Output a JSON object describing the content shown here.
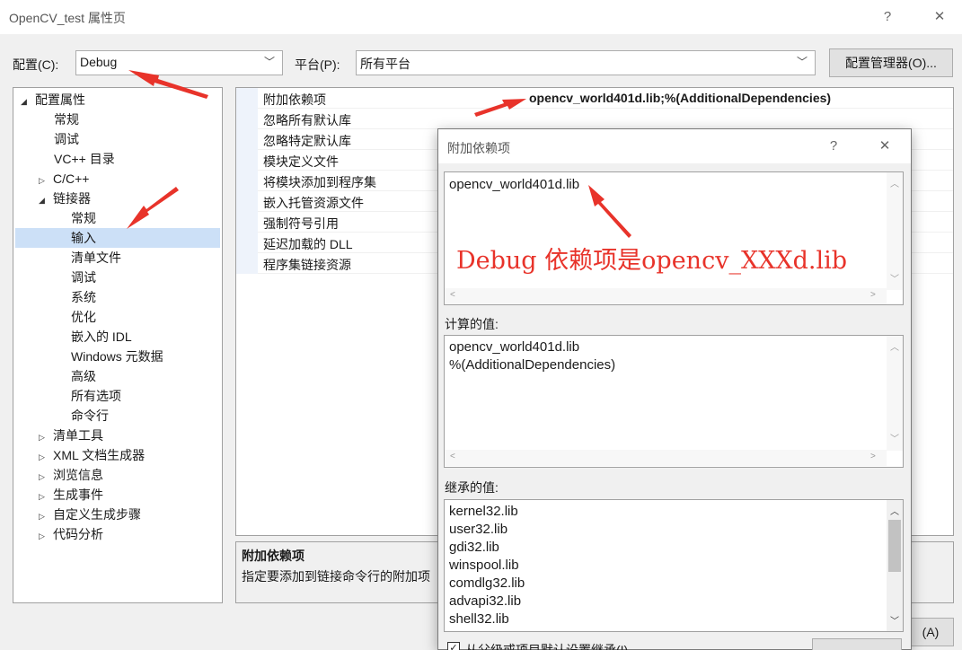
{
  "window": {
    "title": "OpenCV_test 属性页",
    "help_glyph": "?",
    "close_glyph": "✕"
  },
  "config_bar": {
    "config_label": "配置(C):",
    "config_value": "Debug",
    "platform_label": "平台(P):",
    "platform_value": "所有平台",
    "manager_button": "配置管理器(O)..."
  },
  "tree": {
    "root": "配置属性",
    "items": [
      "常规",
      "调试",
      "VC++ 目录",
      "C/C++",
      "链接器",
      "常规",
      "输入",
      "清单文件",
      "调试",
      "系统",
      "优化",
      "嵌入的 IDL",
      "Windows 元数据",
      "高级",
      "所有选项",
      "命令行",
      "清单工具",
      "XML 文档生成器",
      "浏览信息",
      "生成事件",
      "自定义生成步骤",
      "代码分析"
    ],
    "selected": "输入"
  },
  "grid": {
    "rows": [
      "附加依赖项",
      "忽略所有默认库",
      "忽略特定默认库",
      "模块定义文件",
      "将模块添加到程序集",
      "嵌入托管资源文件",
      "强制符号引用",
      "延迟加载的 DLL",
      "程序集链接资源"
    ],
    "first_value": "opencv_world401d.lib;%(AdditionalDependencies)"
  },
  "description": {
    "title": "附加依赖项",
    "text": "指定要添加到链接命令行的附加项"
  },
  "dialog": {
    "title": "附加依赖项",
    "help_glyph": "?",
    "close_glyph": "✕",
    "edit_value": "opencv_world401d.lib",
    "computed_label": "计算的值:",
    "computed_lines": [
      "opencv_world401d.lib",
      "%(AdditionalDependencies)"
    ],
    "inherited_label": "继承的值:",
    "inherited_lines": [
      "kernel32.lib",
      "user32.lib",
      "gdi32.lib",
      "winspool.lib",
      "comdlg32.lib",
      "advapi32.lib",
      "shell32.lib"
    ],
    "inherit_checkbox": "从父级或项目默认设置继承(I)",
    "apply_button": "(A)"
  },
  "annotation": {
    "text": "Debug 依赖项是opencv_XXXd.lib",
    "color": "#e8332a"
  },
  "icons": {
    "expanded": "triangle-down-icon",
    "collapsed": "triangle-right-icon"
  }
}
